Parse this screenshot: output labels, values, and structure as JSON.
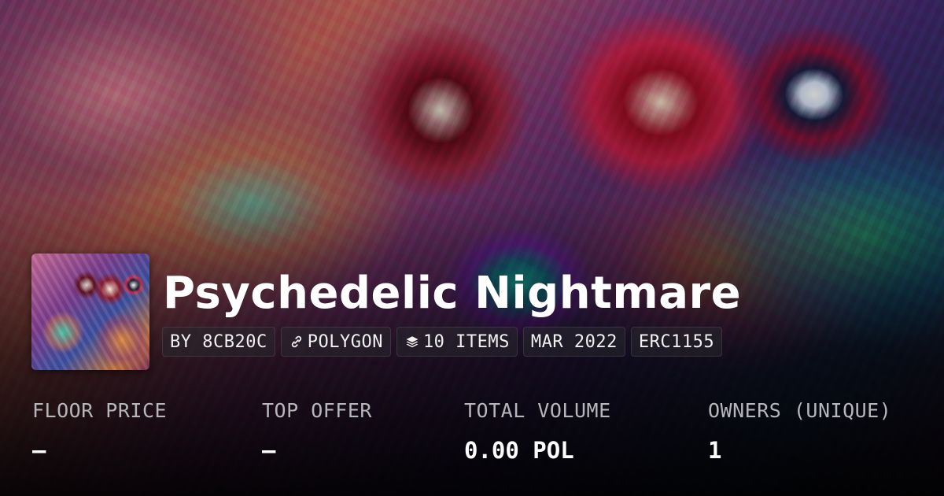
{
  "collection": {
    "title": "Psychedelic Nightmare",
    "thumbnail_icon": "collection-artwork"
  },
  "chips": {
    "creator": "BY 8CB20C",
    "chain": "POLYGON",
    "items": "10 ITEMS",
    "date": "MAR 2022",
    "standard": "ERC1155"
  },
  "stats": {
    "floor_price": {
      "label": "FLOOR PRICE",
      "value": "–"
    },
    "top_offer": {
      "label": "TOP OFFER",
      "value": "–"
    },
    "total_volume": {
      "label": "TOTAL VOLUME",
      "value": "0.00 POL"
    },
    "owners": {
      "label": "OWNERS (UNIQUE)",
      "value": "1"
    }
  },
  "colors": {
    "title": "#ffffff",
    "label": "#b7b7bb",
    "chip_bg": "#28282d"
  },
  "icons": {
    "chain": "polygon-link-icon",
    "items": "layers-icon"
  }
}
